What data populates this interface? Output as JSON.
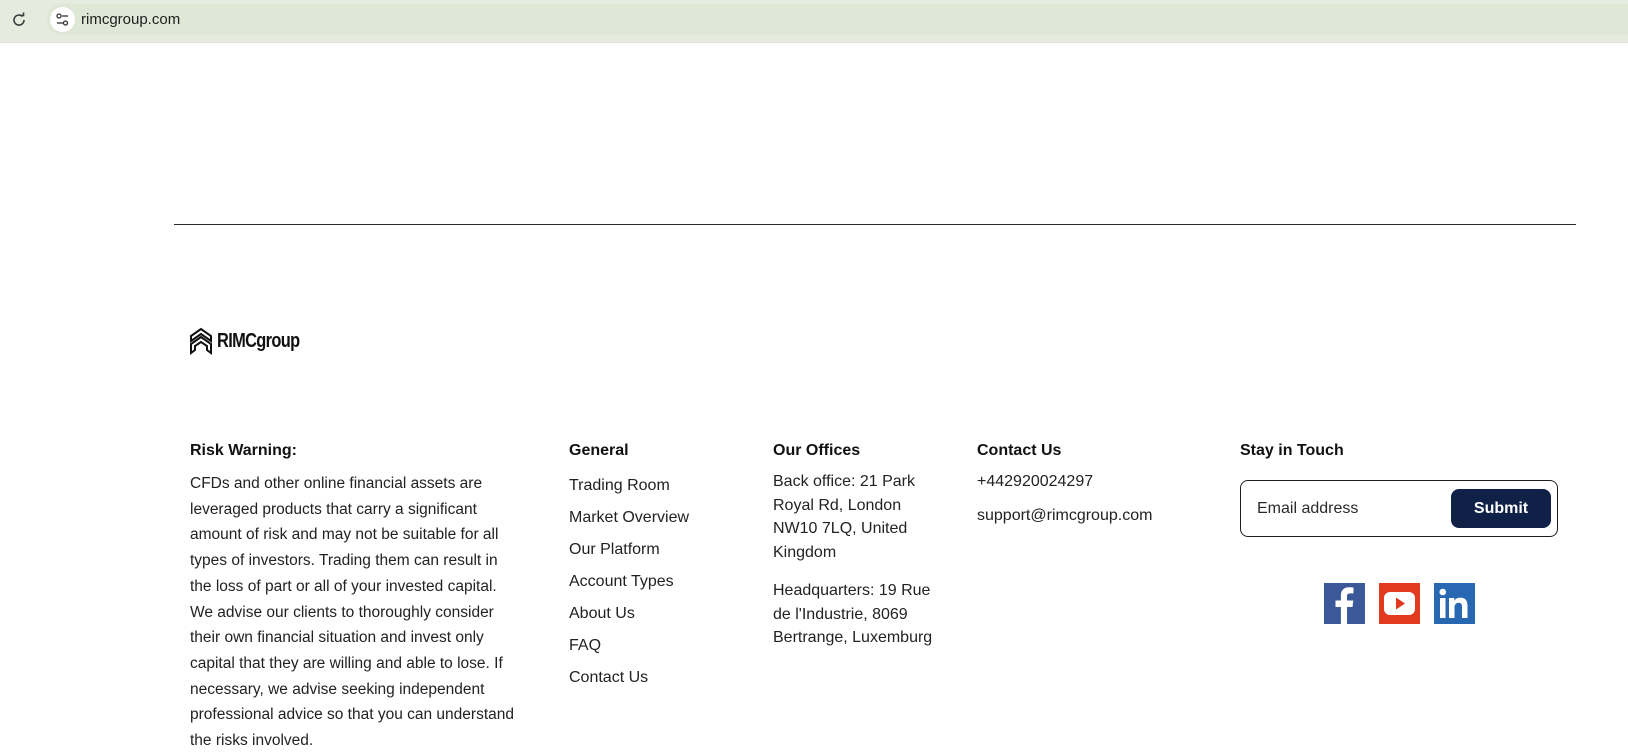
{
  "browser": {
    "url": "rimcgroup.com"
  },
  "logo": {
    "text": "RIMCgroup"
  },
  "risk": {
    "title": "Risk Warning:",
    "text": "CFDs and other online financial assets are leveraged products that carry a significant amount of risk and may not be suitable for all types of investors. Trading them can result in the loss of part or all of your invested capital. We advise our clients to thoroughly consider their own financial situation and invest only capital that they are willing and able to lose. If necessary, we advise seeking independent professional advice so that you can understand the risks involved."
  },
  "general": {
    "title": "General",
    "links": [
      "Trading Room",
      "Market Overview",
      "Our Platform",
      "Account Types",
      "About Us",
      "FAQ",
      "Contact Us"
    ]
  },
  "offices": {
    "title": "Our Offices",
    "back_office": "Back office: 21 Park Royal Rd, London NW10 7LQ, United Kingdom",
    "headquarters": "Headquarters: 19 Rue de l'Industrie, 8069 Bertrange, Luxemburg"
  },
  "contact": {
    "title": "Contact Us",
    "phone": "+442920024297",
    "email": "support@rimcgroup.com"
  },
  "touch": {
    "title": "Stay in Touch",
    "email_placeholder": "Email address",
    "submit_label": "Submit"
  },
  "social": {
    "icons": [
      "facebook-icon",
      "youtube-icon",
      "linkedin-icon"
    ],
    "colors": {
      "facebook": "#3b5998",
      "youtube": "#e23a1e",
      "linkedin": "#2867b2"
    }
  },
  "colors": {
    "browser_bar": "#e5ecdf",
    "submit_bg": "#0f2147"
  }
}
